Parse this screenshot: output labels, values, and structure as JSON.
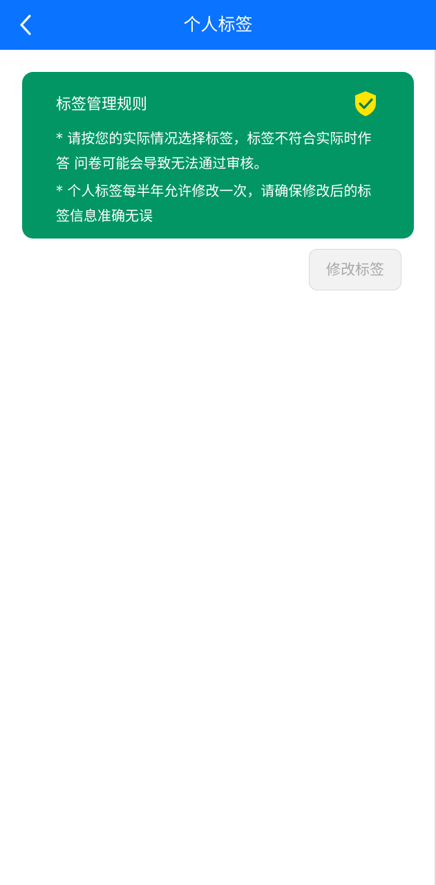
{
  "header": {
    "title": "个人标签",
    "back_icon": "chevron-left-icon"
  },
  "rules_card": {
    "title": "标签管理规则",
    "icon": "shield-check-icon",
    "rule_1": "* 请按您的实际情况选择标签，标签不符合实际时作答 问卷可能会导致无法通过审核。",
    "rule_2": "* 个人标签每半年允许修改一次，请确保修改后的标签信息准确无误"
  },
  "actions": {
    "edit_label": "修改标签"
  },
  "colors": {
    "header_bg": "#0a73ff",
    "card_bg": "#019664",
    "shield": "#ffe500"
  }
}
